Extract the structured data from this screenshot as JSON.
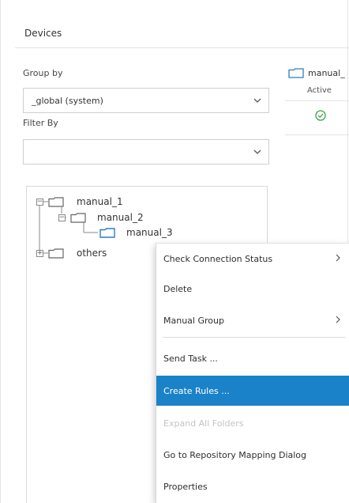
{
  "devices_title": "Devices",
  "group_by": {
    "label": "Group by",
    "value": "_global (system)"
  },
  "filter_by": {
    "label": "Filter By",
    "value": ""
  },
  "tree": {
    "nodes": [
      {
        "label": "manual_1",
        "expander": "−"
      },
      {
        "label": "manual_2",
        "expander": "−"
      },
      {
        "label": "manual_3",
        "expander": ""
      },
      {
        "label": "others",
        "expander": "+"
      }
    ]
  },
  "device_column": {
    "name": "manual_",
    "status": "Active"
  },
  "context_menu": {
    "items": [
      {
        "label": "Check Connection Status",
        "has_submenu": true
      },
      {
        "label": "Delete",
        "has_submenu": false
      },
      {
        "label": "Manual Group",
        "has_submenu": true
      },
      {
        "label": "Send Task ...",
        "has_submenu": false
      },
      {
        "label": "Create Rules ...",
        "has_submenu": false,
        "state": "highlighted"
      },
      {
        "label": "Expand All Folders",
        "has_submenu": false,
        "state": "disabled"
      },
      {
        "label": "Go to Repository Mapping Dialog",
        "has_submenu": false
      },
      {
        "label": "Properties",
        "has_submenu": false
      }
    ]
  },
  "colors": {
    "accent": "#1a82c8",
    "folder": "#2a7fc0",
    "ok": "#3aa14a"
  },
  "icons": {
    "folder": "folder-icon",
    "chevron": "chevron-down-icon",
    "submenu": "chevron-right-icon",
    "status": "check-circle-icon"
  }
}
